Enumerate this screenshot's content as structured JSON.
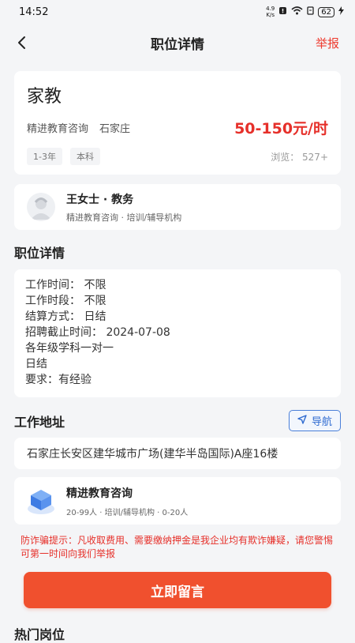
{
  "status_bar": {
    "time": "14:52",
    "net_speed_value": "4.9",
    "net_speed_unit": "K/s",
    "battery": "62"
  },
  "nav": {
    "title": "职位详情",
    "report_label": "举报"
  },
  "job": {
    "title": "家教",
    "company": "精进教育咨询",
    "city": "石家庄",
    "salary": "50-150元/时",
    "tags": [
      "1-3年",
      "本科"
    ],
    "views": "浏览： 527+"
  },
  "contact": {
    "name": "王女士 · 教务",
    "subtitle": "精进教育咨询 · 培训/辅导机构"
  },
  "details": {
    "section_title": "职位详情",
    "lines": [
      "工作时间： 不限",
      "工作时段： 不限",
      "结算方式： 日结",
      "招聘截止时间： 2024-07-08",
      "各年级学科一对一",
      "日结",
      "要求：有经验"
    ]
  },
  "address": {
    "section_title": "工作地址",
    "nav_button_label": "导航",
    "text": "石家庄长安区建华城市广场(建华半岛国际)A座16楼"
  },
  "company_card": {
    "name": "精进教育咨询",
    "subtitle": "20-99人 · 培训/辅导机构 · 0-20人"
  },
  "warning": "防诈骗提示：凡收取费用、需要缴纳押金是我企业均有欺诈嫌疑，请您警惕可第一时间向我们举报",
  "cta_label": "立即留言",
  "hot_title": "热门岗位",
  "colors": {
    "accent_red": "#e6302a",
    "cta_orange": "#f0502e",
    "link_blue": "#2f6bd1"
  }
}
